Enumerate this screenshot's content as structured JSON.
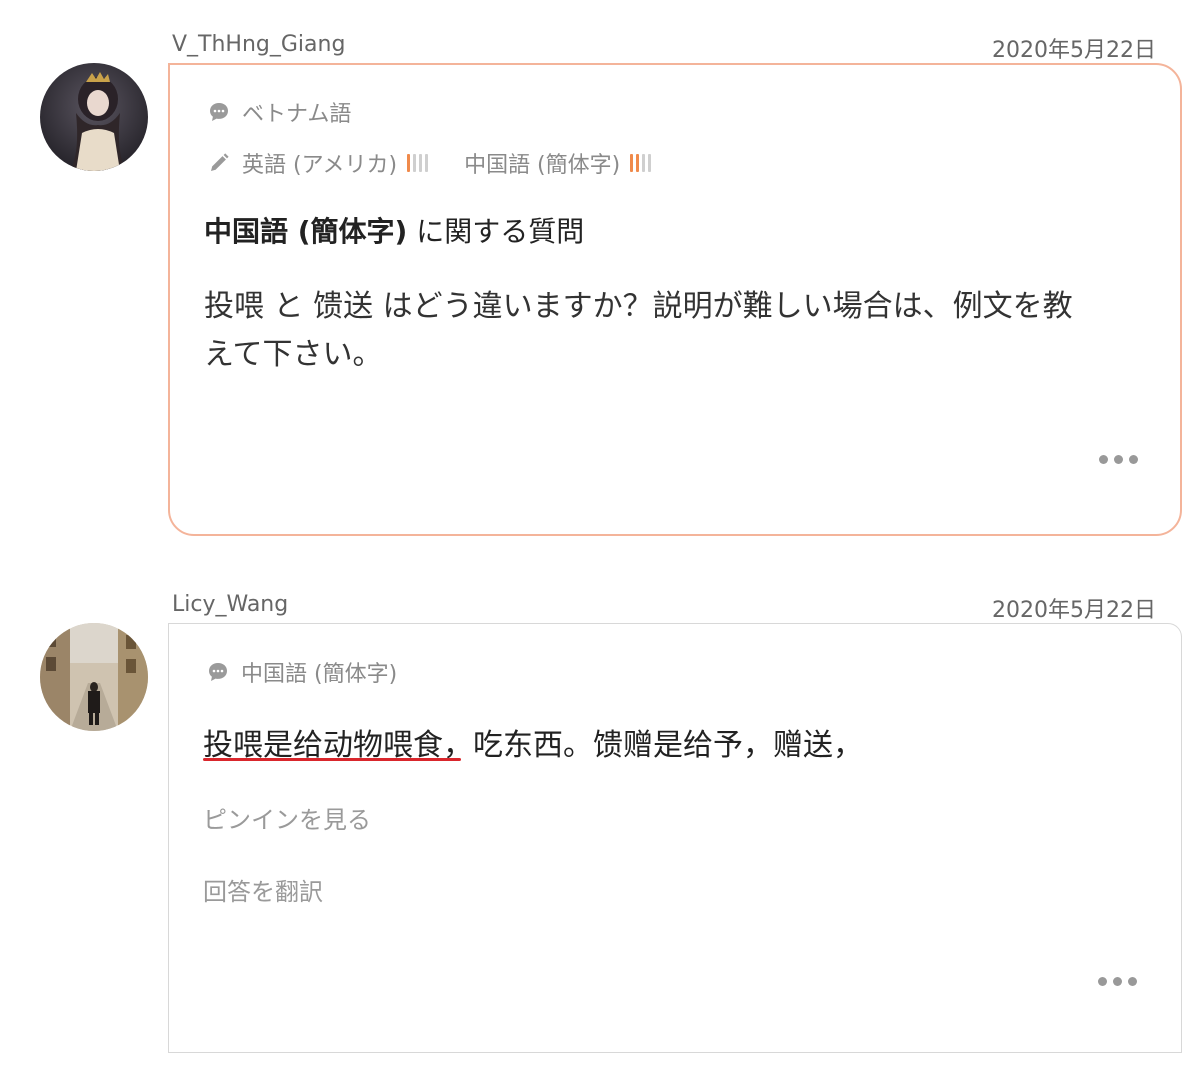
{
  "question": {
    "username": "V_ThHng_Giang",
    "date": "2020年5月22日",
    "native_language": "ベトナム語",
    "learning": [
      {
        "label": "英語 (アメリカ)",
        "level": 1
      },
      {
        "label": "中国語 (簡体字)",
        "level": 2
      }
    ],
    "title_bold": "中国語 (簡体字)",
    "title_rest": " に関する質問",
    "body_line1": "投喂 と 馈送 はどう違いますか？説明が難しい場合は、例文を教",
    "body_line2": "えて下さい。"
  },
  "answer": {
    "username": "Licy_Wang",
    "date": "2020年5月22日",
    "language": "中国語 (簡体字)",
    "text": "投喂是给动物喂食，吃东西。馈赠是给予，赠送，",
    "pinyin_link": "ピンインを見る",
    "translate_link": "回答を翻訳"
  },
  "colors": {
    "question_border": "#f4b49a",
    "level_active": "#f08a4b",
    "underline": "#d9262c"
  },
  "icons": [
    "speech-bubble-icon",
    "pencil-icon",
    "more-dots-icon",
    "avatar"
  ]
}
